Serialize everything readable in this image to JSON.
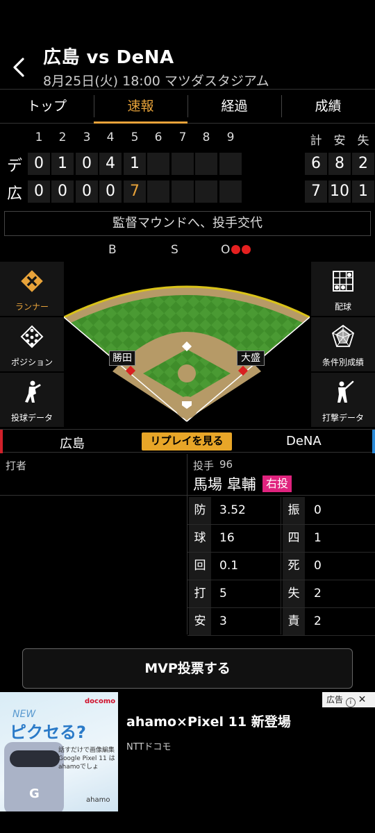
{
  "header": {
    "title": "広島 vs DeNA",
    "subtitle": "8月25日(火) 18:00 マツダスタジアム",
    "back_icon": "chevron-left-icon"
  },
  "tabs": [
    {
      "label": "トップ",
      "active": false
    },
    {
      "label": "速報",
      "active": true
    },
    {
      "label": "経過",
      "active": false
    },
    {
      "label": "成績",
      "active": false
    }
  ],
  "scoreboard": {
    "innings": [
      "1",
      "2",
      "3",
      "4",
      "5",
      "6",
      "7",
      "8",
      "9"
    ],
    "totals_headers": [
      "計",
      "安",
      "失"
    ],
    "teams": [
      {
        "abbr": "デ",
        "scores": [
          "0",
          "1",
          "0",
          "4",
          "1",
          "",
          "",
          "",
          ""
        ],
        "totals": [
          "6",
          "8",
          "2"
        ]
      },
      {
        "abbr": "広",
        "scores": [
          "0",
          "0",
          "0",
          "0",
          "7",
          "",
          "",
          "",
          ""
        ],
        "totals": [
          "7",
          "10",
          "1"
        ]
      }
    ],
    "highlight_color": "#e8a33a"
  },
  "play_text": "監督マウンドへ、投手交代",
  "count": {
    "b_label": "B",
    "s_label": "S",
    "o_label": "O",
    "balls": 0,
    "strikes": 0,
    "outs": 2
  },
  "left_buttons": [
    {
      "label": "ランナー",
      "icon": "runner-diamond-icon",
      "active": true
    },
    {
      "label": "ポジション",
      "icon": "positions-icon",
      "active": false
    },
    {
      "label": "投球データ",
      "icon": "pitcher-icon",
      "active": false
    }
  ],
  "right_buttons": [
    {
      "label": "配球",
      "icon": "pitch-grid-icon"
    },
    {
      "label": "条件別成績",
      "icon": "radar-chart-icon"
    },
    {
      "label": "打撃データ",
      "icon": "batter-icon"
    }
  ],
  "field": {
    "runners": [
      {
        "base": "3B",
        "name": "勝田"
      },
      {
        "base": "1B",
        "name": "大盛"
      }
    ]
  },
  "team_bar": {
    "home": "広島",
    "away": "DeNA",
    "replay_label": "リプレイを見る"
  },
  "batter": {
    "label": "打者"
  },
  "pitcher": {
    "label": "投手",
    "number": "96",
    "name": "馬場 皐輔",
    "throws": "右投",
    "stats": [
      {
        "k": "防",
        "v": "3.52",
        "k2": "振",
        "v2": "0"
      },
      {
        "k": "球",
        "v": "16",
        "k2": "四",
        "v2": "1"
      },
      {
        "k": "回",
        "v": "0.1",
        "k2": "死",
        "v2": "0"
      },
      {
        "k": "打",
        "v": "5",
        "k2": "失",
        "v2": "2"
      },
      {
        "k": "安",
        "v": "3",
        "k2": "責",
        "v2": "2"
      }
    ]
  },
  "mvp_button": "MVP投票する",
  "ad": {
    "title": "ahamo×Pixel 11 新登場",
    "sponsor": "NTTドコモ",
    "tag": "広告",
    "image_text": {
      "logo": "docomo",
      "new": "NEW",
      "headline": "ピクセる?",
      "body": "話すだけで画像編集 Google Pixel 11 は ahamoでしょ",
      "brand": "ahamo"
    }
  }
}
